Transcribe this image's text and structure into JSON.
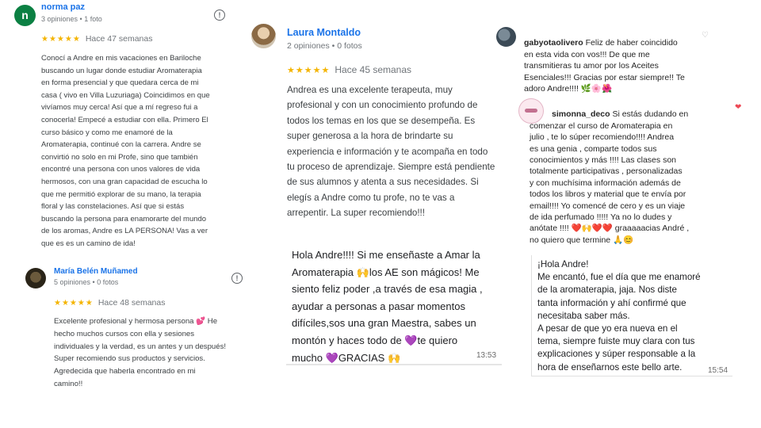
{
  "reviews": [
    {
      "name": "norma paz",
      "initial": "n",
      "meta": "3 opiniones • 1 foto",
      "stars": "★★★★★",
      "when": "Hace 47 semanas",
      "text": "Conocí a Andre en mis vacaciones en Bariloche\nbuscando un lugar donde estudiar Aromaterapia\nen forma presencial y que quedara cerca de mi\ncasa ( vivo en Villa Luzuriaga) Coincidimos en que\nvivíamos muy cerca! Así que a mí regreso fui a\nconocerla! Empecé a estudiar con ella. Primero El\ncurso básico y como me enamoré de la\nAromaterapia, continué con la carrera. Andre se\nconvirtió no solo en mi Profe, sino que también\nencontré una persona con unos valores de vida\nhermosos, con una gran capacidad de escucha lo\nque me permitió explorar de su mano, la terapia\nfloral y las constelaciones. Así que si estás\nbuscando la persona para enamorarte del mundo\nde los aromas, Andre es LA PERSONA! Vas a ver\nque es es un camino de ida!",
      "avatar_color": "#0b8043"
    },
    {
      "name": "Laura Montaldo",
      "meta": "2 opiniones • 0 fotos",
      "stars": "★★★★★",
      "when": "Hace 45 semanas",
      "text": "Andrea es una excelente terapeuta, muy\nprofesional y con un conocimiento profundo de\ntodos los temas en los que se desempeña. Es\nsuper generosa a la hora de brindarte su\nexperiencia e información y te acompaña en todo\ntu proceso de aprendizaje. Siempre está pendiente\nde sus alumnos y atenta a sus necesidades. Si\nelegís a Andre como tu profe, no te vas a\narrepentir. La super recomiendo!!!"
    },
    {
      "name": "María Belén Muñamed",
      "meta": "5 opiniones • 0 fotos",
      "stars": "★★★★★",
      "when": "Hace 48 semanas",
      "text": "Excelente profesional y hermosa persona 💕 He\nhecho muchos cursos con ella y sesiones\nindividuales y la verdad, es un antes y un después!\nSuper recomiendo sus productos y servicios.\nAgredecida que haberla encontrado en mi\ncamino!!"
    }
  ],
  "instagram": [
    {
      "user": "gabyotaolivero",
      "text": " Feliz de haber coincidido\nen esta vida con vos!!! De que me\ntransmitieras tu amor por los Aceites\nEsenciales!!! Gracias por estar siempre!! Te\nadoro Andre!!!! 🌿🌸🌺"
    },
    {
      "user": "simonna_deco",
      "text": " Si estás dudando en\ncomenzar el curso de Aromaterapia en\njulio , te lo súper recomiendo!!!! Andrea\nes una genia , comparte todos sus\nconocimientos y más !!!! Las clases son\ntotalmente participativas , personalizadas\ny con muchísima información además de\ntodos los libros y material que te envía por\nemail!!!! Yo comencé de cero y es un viaje\nde ida perfumado !!!!! Ya no lo dudes y\nanótate !!!! ❤️🙌❤️❤️ graaaaacias André ,\nno quiero que termine 🙏😊"
    }
  ],
  "chats": [
    {
      "text": "Hola Andre!!!! Si me enseñaste a Amar la\nAromaterapia 🙌los AE son mágicos! Me\nsiento feliz poder ,a través  de esa magia ,\nayudar a personas a pasar momentos\ndifíciles,sos una gran Maestra, sabes un\nmontón y haces todo de 💜te quiero\nmucho 💜GRACIAS 🙌",
      "time": "13:53"
    },
    {
      "text": "¡Hola Andre!\nMe encantó, fue el día que me enamoré\nde la aromaterapia, jaja. Nos diste\ntanta información y ahí confirmé que\nnecesitaba saber más.\nA pesar de que yo era nueva en el\ntema, siempre fuiste muy clara con tus\nexplicaciones y súper responsable a la\nhora de enseñarnos este bello arte.",
      "time": "15:54"
    }
  ],
  "icons": {
    "flag": "flag-icon",
    "heart": "heart-icon",
    "ig_heart": "heart-outline-icon"
  },
  "colors": {
    "name_blue": "#1a73e8",
    "star_yellow": "#f4b400",
    "heart_red": "#ed4956"
  }
}
